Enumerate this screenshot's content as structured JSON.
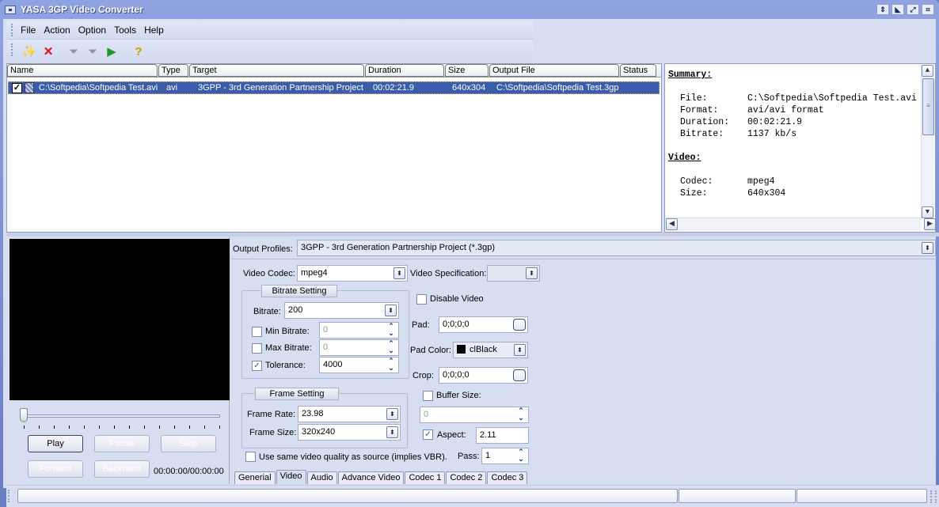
{
  "window": {
    "title": "YASA 3GP Video Converter",
    "controls": [
      "roll-up",
      "minimize",
      "maximize",
      "close"
    ]
  },
  "menu": [
    "File",
    "Action",
    "Option",
    "Tools",
    "Help"
  ],
  "toolbar": [
    {
      "name": "add-file-wand-icon",
      "glyph": "✨",
      "enabled": true
    },
    {
      "name": "remove-x-icon",
      "glyph": "✕",
      "enabled": true
    },
    {
      "name": "convert-selected-funnel-icon",
      "glyph": "⏷",
      "enabled": false
    },
    {
      "name": "convert-all-funnel-icon",
      "glyph": "⏷",
      "enabled": false
    },
    {
      "name": "start-convert-funnel-icon",
      "glyph": "▶",
      "enabled": true
    },
    {
      "name": "help-document-icon",
      "glyph": "?",
      "enabled": true
    }
  ],
  "filelist": {
    "columns": [
      "Name",
      "Type",
      "Target",
      "Duration",
      "Size",
      "Output File",
      "Status"
    ],
    "rows": [
      {
        "checked": true,
        "name": "C:\\Softpedia\\Softpedia Test.avi",
        "type": "avi",
        "target": "3GPP - 3rd Generation Partnership Project",
        "duration": "00:02:21.9",
        "size": "640x304",
        "output": "C:\\Softpedia\\Softpedia Test.3gp",
        "status": ""
      }
    ]
  },
  "summary": {
    "heading": "Summary:",
    "items": [
      {
        "k": "File:",
        "v": "C:\\Softpedia\\Softpedia Test.avi"
      },
      {
        "k": "Format:",
        "v": "avi/avi format"
      },
      {
        "k": "Duration:",
        "v": "00:02:21.9"
      },
      {
        "k": "Bitrate:",
        "v": "1137 kb/s"
      }
    ],
    "video_heading": "Video:",
    "video_items": [
      {
        "k": "Codec:",
        "v": "mpeg4"
      },
      {
        "k": "Size:",
        "v": "640x304"
      }
    ]
  },
  "player": {
    "position_fraction": 0,
    "buttons": {
      "play": "Play",
      "pause": "Pause",
      "stop": "Stop",
      "forward": "Forward",
      "backward": "Backward"
    },
    "timecode": "00:00:00/00:00:00"
  },
  "settings": {
    "output_profiles_label": "Output Profiles:",
    "output_profile": "3GPP - 3rd Generation Partnership Project (*.3gp)",
    "video_codec_label": "Video Codec:",
    "video_codec": "mpeg4",
    "video_spec_label": "Video Specification:",
    "video_spec": "",
    "bitrate_group": "Bitrate Setting",
    "bitrate_label": "Bitrate:",
    "bitrate": "200",
    "min_bitrate_label": "Min Bitrate:",
    "min_bitrate": "0",
    "min_bitrate_checked": false,
    "max_bitrate_label": "Max Bitrate:",
    "max_bitrate": "0",
    "max_bitrate_checked": false,
    "tolerance_label": "Tolerance:",
    "tolerance": "4000",
    "tolerance_checked": true,
    "frame_group": "Frame Setting",
    "frame_rate_label": "Frame Rate:",
    "frame_rate": "23.98",
    "frame_size_label": "Frame Size:",
    "frame_size": "320x240",
    "same_quality_label": "Use same video quality as source (implies VBR).",
    "same_quality_checked": false,
    "disable_video_label": "Disable Video",
    "disable_video_checked": false,
    "pad_label": "Pad:",
    "pad": "0;0;0;0",
    "pad_color_label": "Pad Color:",
    "pad_color": "clBlack",
    "pad_color_hex": "#000000",
    "crop_label": "Crop:",
    "crop": "0;0;0;0",
    "buffer_size_label": "Buffer Size:",
    "buffer_size_checked": false,
    "buffer_size": "0",
    "aspect_label": "Aspect:",
    "aspect_checked": true,
    "aspect": "2.11",
    "pass_label": "Pass:",
    "pass": "1"
  },
  "tabs": [
    {
      "label": "Generial",
      "active": false
    },
    {
      "label": "Video",
      "active": true
    },
    {
      "label": "Audio",
      "active": false
    },
    {
      "label": "Advance Video",
      "active": false
    },
    {
      "label": "Codec 1",
      "active": false
    },
    {
      "label": "Codec 2",
      "active": false
    },
    {
      "label": "Codec 3",
      "active": false
    }
  ],
  "colors": {
    "selection": "#3a5cab",
    "panel": "#d7def2",
    "frame": "#7b8fd0"
  }
}
